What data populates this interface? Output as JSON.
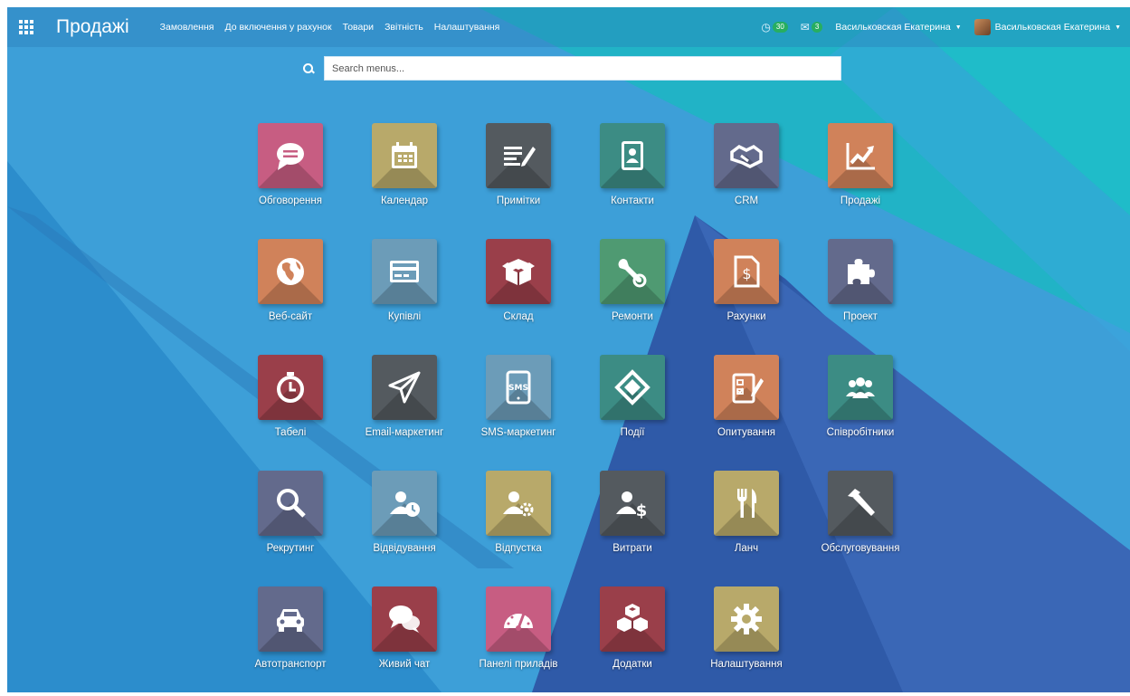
{
  "navbar": {
    "brand": "Продажі",
    "menu": [
      "Замовлення",
      "До включення у рахунок",
      "Товари",
      "Звітність",
      "Налаштування"
    ],
    "activity_count": "30",
    "message_count": "3",
    "company": "Васильковская Екатерина",
    "user": "Васильковская Екатерина"
  },
  "search": {
    "placeholder": "Search menus..."
  },
  "apps": [
    {
      "label": "Обговорення",
      "color": "#c75d82",
      "icon": "chat-icon"
    },
    {
      "label": "Календар",
      "color": "#b8a96a",
      "icon": "calendar-icon"
    },
    {
      "label": "Примітки",
      "color": "#545a5f",
      "icon": "notes-icon"
    },
    {
      "label": "Контакти",
      "color": "#3c8c84",
      "icon": "contacts-icon"
    },
    {
      "label": "CRM",
      "color": "#636a8c",
      "icon": "handshake-icon"
    },
    {
      "label": "Продажі",
      "color": "#d0825a",
      "icon": "chart-up-icon"
    },
    {
      "label": "Веб-сайт",
      "color": "#d0825a",
      "icon": "globe-icon"
    },
    {
      "label": "Купівлі",
      "color": "#6c9cb8",
      "icon": "credit-card-icon"
    },
    {
      "label": "Склад",
      "color": "#9a3f4a",
      "icon": "box-icon"
    },
    {
      "label": "Ремонти",
      "color": "#4f9a72",
      "icon": "wrench-icon"
    },
    {
      "label": "Рахунки",
      "color": "#d0825a",
      "icon": "invoice-icon"
    },
    {
      "label": "Проект",
      "color": "#636a8c",
      "icon": "puzzle-icon"
    },
    {
      "label": "Табелі",
      "color": "#9a3f4a",
      "icon": "stopwatch-icon"
    },
    {
      "label": "Email-маркетинг",
      "color": "#545a5f",
      "icon": "paper-plane-icon"
    },
    {
      "label": "SMS-маркетинг",
      "color": "#6c9cb8",
      "icon": "sms-phone-icon"
    },
    {
      "label": "Події",
      "color": "#3c8c84",
      "icon": "ticket-icon"
    },
    {
      "label": "Опитування",
      "color": "#d0825a",
      "icon": "survey-icon"
    },
    {
      "label": "Співробітники",
      "color": "#3c8c84",
      "icon": "people-icon"
    },
    {
      "label": "Рекрутинг",
      "color": "#636a8c",
      "icon": "magnifier-icon"
    },
    {
      "label": "Відвідування",
      "color": "#6c9cb8",
      "icon": "user-clock-icon"
    },
    {
      "label": "Відпустка",
      "color": "#b8a96a",
      "icon": "user-gear-icon"
    },
    {
      "label": "Витрати",
      "color": "#545a5f",
      "icon": "user-dollar-icon"
    },
    {
      "label": "Ланч",
      "color": "#b8a96a",
      "icon": "fork-knife-icon"
    },
    {
      "label": "Обслуговування",
      "color": "#545a5f",
      "icon": "hammer-icon"
    },
    {
      "label": "Автотранспорт",
      "color": "#636a8c",
      "icon": "car-icon"
    },
    {
      "label": "Живий чат",
      "color": "#9a3f4a",
      "icon": "chat-bubbles-icon"
    },
    {
      "label": "Панелі приладів",
      "color": "#c75d82",
      "icon": "dashboard-icon"
    },
    {
      "label": "Додатки",
      "color": "#9a3f4a",
      "icon": "cubes-icon"
    },
    {
      "label": "Налаштування",
      "color": "#b8a96a",
      "icon": "gear-icon"
    }
  ]
}
